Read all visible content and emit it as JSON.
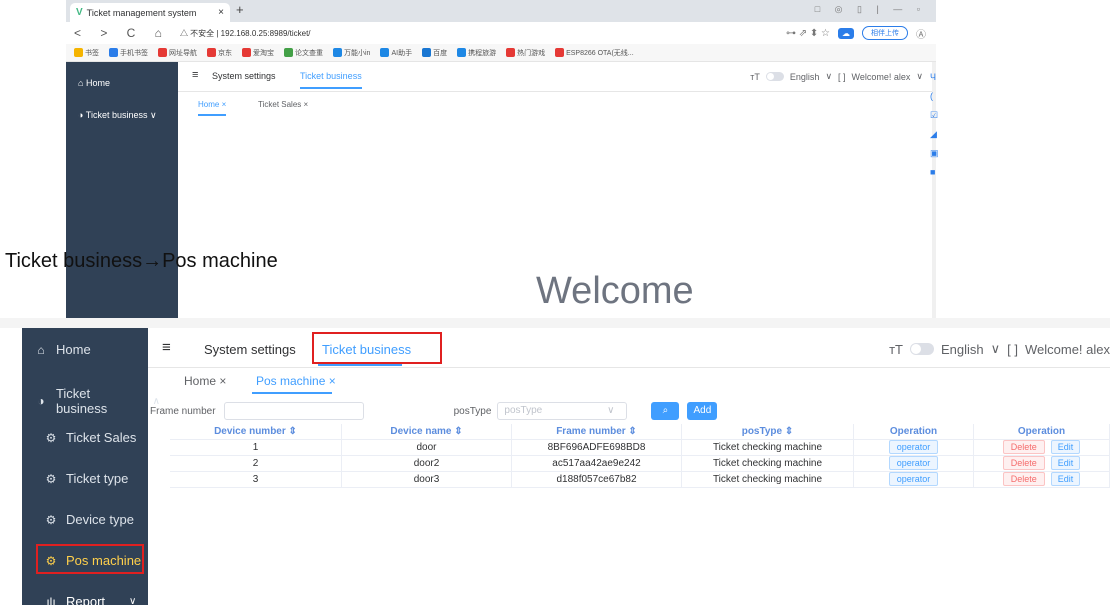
{
  "caption": "Ticket business→Pos machine",
  "top": {
    "browser_tab_title": "Ticket management system",
    "browser_tab_close": "×",
    "new_tab": "+",
    "window_controls": "□ ◎ ▯ | — ▫",
    "nav_buttons": "< > C ⌂",
    "url": "△ 不安全 | 192.168.0.25:8989/ticket/",
    "addr_icons": "⊶ ⇗ ⬍ ☆",
    "sync_label": "相伴上传",
    "avatar": "Ⓐ",
    "bookmarks": [
      "书签",
      "手机书签",
      "网址导航",
      "京东",
      "爱淘宝",
      "论文查重",
      "万能小in",
      "AI助手",
      "百度",
      "携程旅游",
      "热门游戏",
      "ESP8266 OTA(无线..."
    ],
    "bookmark_colors": [
      "#f5b400",
      "#2b7de9",
      "#e53935",
      "#e53935",
      "#e53935",
      "#43a047",
      "#1e88e5",
      "#1e88e5",
      "#1976d2",
      "#1e88e5",
      "#e53935",
      "#e53935"
    ],
    "sidebar": {
      "home": "Home",
      "ticket_business": "Ticket business",
      "chevron": "∨"
    },
    "header": {
      "menu_icon": "≡",
      "tab_system": "System settings",
      "tab_ticket": "Ticket business",
      "font_icon": "тT",
      "language": "English",
      "fullscreen_icon": "[ ]",
      "welcome": "Welcome! alex",
      "chevron": "∨"
    },
    "tags": {
      "home": "Home ×",
      "ticket_sales": "Ticket Sales ×"
    },
    "welcome_text": "Welcome",
    "float_icon": "◐",
    "side_icons": [
      "Ч",
      "(",
      "☑",
      "◢",
      "▣",
      "■"
    ]
  },
  "bottom": {
    "sidebar": {
      "items": [
        {
          "label": "Home",
          "icon": "⌂"
        },
        {
          "label": "Ticket business",
          "icon": "◑",
          "chevron": "∧"
        },
        {
          "label": "Ticket Sales",
          "icon": "⚙"
        },
        {
          "label": "Ticket type",
          "icon": "⚙"
        },
        {
          "label": "Device type",
          "icon": "⚙"
        },
        {
          "label": "Pos machine",
          "icon": "⚙"
        },
        {
          "label": "Report",
          "icon": "ılı",
          "chevron": "∨"
        }
      ]
    },
    "header": {
      "menu_icon": "≡",
      "tab_system": "System settings",
      "tab_ticket": "Ticket business",
      "font_icon": "тT",
      "language": "English",
      "fullscreen_icon": "[ ]",
      "welcome": "Welcome! alex",
      "chevron": "∨"
    },
    "tags": {
      "home": "Home ×",
      "pos_machine": "Pos machine ×"
    },
    "search": {
      "frame_label": "Frame number",
      "frame_value": "",
      "postype_label": "posType",
      "postype_placeholder": "posType",
      "select_chevron": "∨",
      "search_icon": "⌕",
      "add_label": "Add"
    },
    "table": {
      "headers": [
        "Device number ⇕",
        "Device name ⇕",
        "Frame number ⇕",
        "posType ⇕",
        "Operation",
        "Operation"
      ],
      "rows": [
        {
          "device_number": "1",
          "device_name": "door",
          "frame_number": "8BF696ADFE698BD8",
          "pos_type": "Ticket checking machine"
        },
        {
          "device_number": "2",
          "device_name": "door2",
          "frame_number": "ac517aa42ae9e242",
          "pos_type": "Ticket checking machine"
        },
        {
          "device_number": "3",
          "device_name": "door3",
          "frame_number": "d188f057ce67b82",
          "pos_type": "Ticket checking machine"
        }
      ],
      "operator_label": "operator",
      "delete_label": "Delete",
      "edit_label": "Edit"
    }
  },
  "colors": {
    "sidebar_bg": "#304156",
    "accent": "#409eff",
    "active_menu": "#ffd04b",
    "highlight_box": "#e02020",
    "danger": "#f56c6c"
  }
}
